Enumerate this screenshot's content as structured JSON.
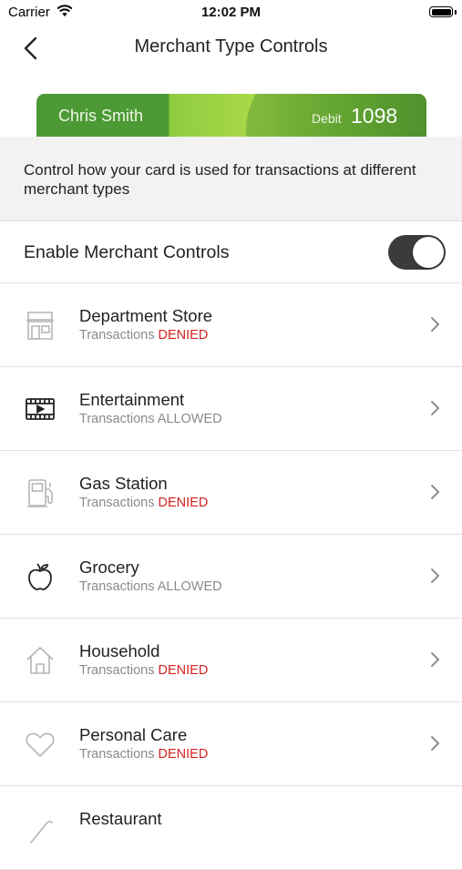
{
  "status_bar": {
    "carrier": "Carrier",
    "time": "12:02 PM",
    "battery_level": 1.0
  },
  "nav": {
    "title": "Merchant Type Controls"
  },
  "card": {
    "holder": "Chris Smith",
    "type": "Debit",
    "last4": "1098"
  },
  "description": "Control how your card is used for transactions at different merchant types",
  "enable_controls": {
    "label": "Enable Merchant Controls",
    "on": true
  },
  "merchants": [
    {
      "name": "Department Store",
      "prefix": "Transactions",
      "status": "DENIED",
      "icon": "storefront-icon"
    },
    {
      "name": "Entertainment",
      "prefix": "Transactions",
      "status": "ALLOWED",
      "icon": "film-icon"
    },
    {
      "name": "Gas Station",
      "prefix": "Transactions",
      "status": "DENIED",
      "icon": "gas-pump-icon"
    },
    {
      "name": "Grocery",
      "prefix": "Transactions",
      "status": "ALLOWED",
      "icon": "apple-icon"
    },
    {
      "name": "Household",
      "prefix": "Transactions",
      "status": "DENIED",
      "icon": "house-icon"
    },
    {
      "name": "Personal Care",
      "prefix": "Transactions",
      "status": "DENIED",
      "icon": "heart-icon"
    },
    {
      "name": "Restaurant",
      "prefix": "",
      "status": "",
      "icon": "utensils-icon"
    }
  ],
  "colors": {
    "denied": "#d42020",
    "allowed": "#8a8a8a",
    "toggle_on": "#3b3b3b",
    "card_green": "#4c9a35"
  }
}
